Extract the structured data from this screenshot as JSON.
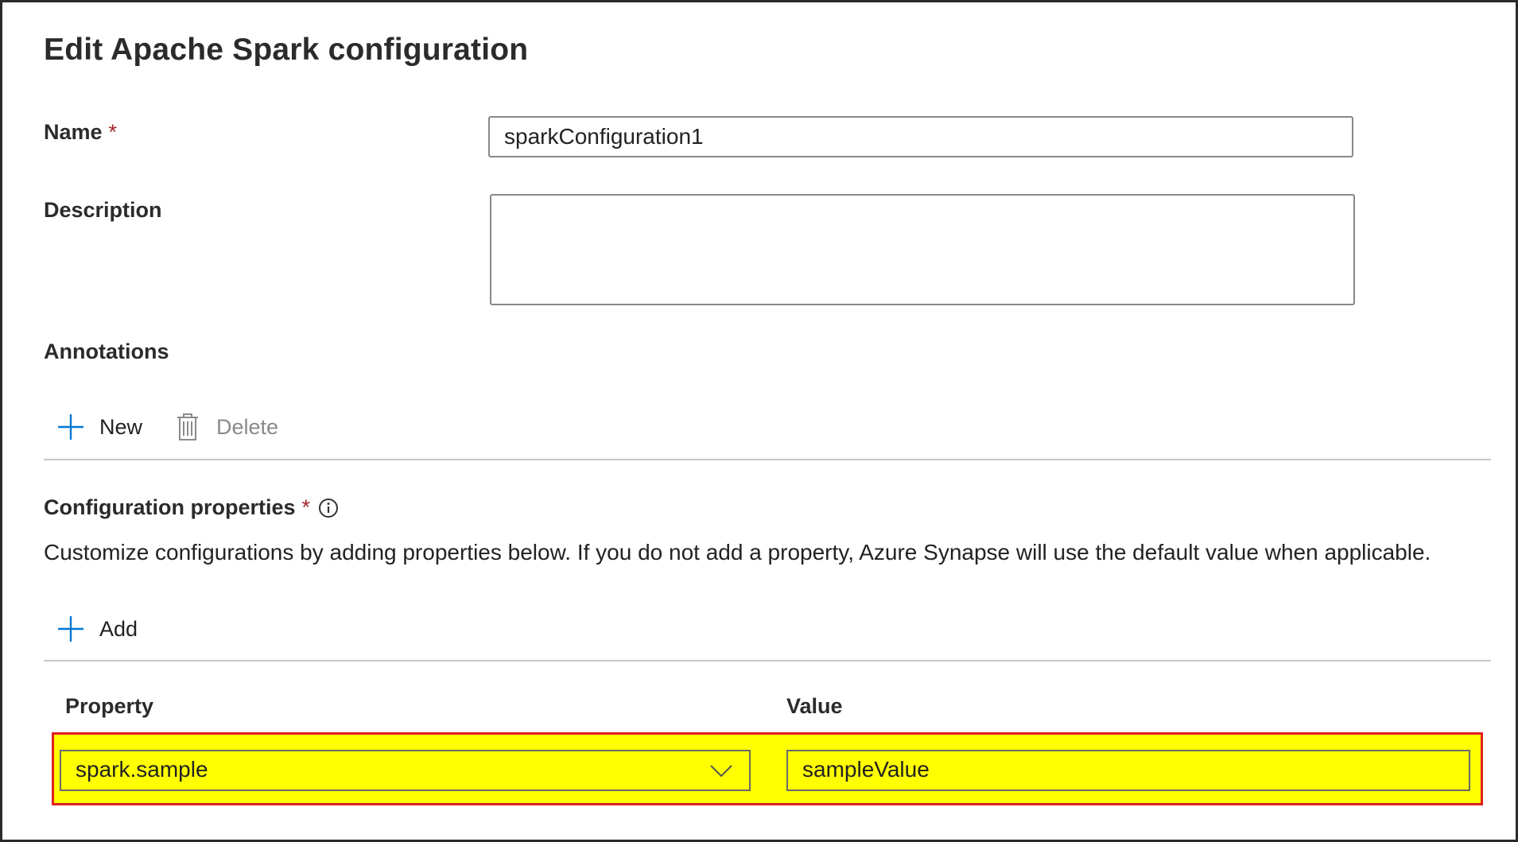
{
  "dialog": {
    "title": "Edit Apache Spark configuration"
  },
  "fields": {
    "name_label": "Name",
    "required_marker": "*",
    "name_value": "sparkConfiguration1",
    "description_label": "Description",
    "description_value": ""
  },
  "annotations": {
    "heading": "Annotations",
    "new_label": "New",
    "delete_label": "Delete"
  },
  "config": {
    "heading": "Configuration properties",
    "required_marker": "*",
    "description": "Customize configurations by adding properties below. If you do not add a property, Azure Synapse will use the default value when applicable.",
    "add_label": "Add",
    "columns": {
      "property": "Property",
      "value": "Value"
    },
    "rows": [
      {
        "property": "spark.sample",
        "value": "sampleValue"
      }
    ]
  },
  "colors": {
    "accent": "#0078d4",
    "required": "#a4262c",
    "highlight": "#ffff00",
    "highlight_border": "#e02020"
  },
  "icons": {
    "new": "plus-icon",
    "delete": "trash-icon",
    "info": "info-icon",
    "add": "plus-icon",
    "dropdown": "chevron-down-icon"
  }
}
